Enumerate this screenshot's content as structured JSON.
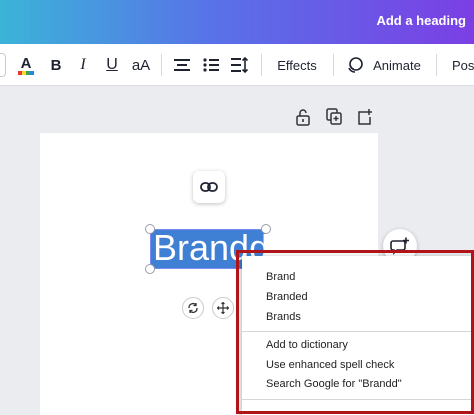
{
  "header": {
    "add_heading": "Add a heading"
  },
  "toolbar": {
    "text_color_icon": "text-color-icon",
    "bold_label": "B",
    "italic_label": "I",
    "underline_label": "U",
    "case_label": "aA",
    "effects_label": "Effects",
    "animate_label": "Animate",
    "position_label": "Pos"
  },
  "colors": {
    "accent_gradient_start": "#3bb4d8",
    "accent_gradient_end": "#7b3fe4",
    "selection": "#3f7fd4",
    "highlight_outline": "#b01418"
  },
  "canvas": {
    "text_value": "Brandd"
  },
  "context_menu": {
    "suggestions": [
      "Brand",
      "Branded",
      "Brands"
    ],
    "add_to_dictionary": "Add to dictionary",
    "enhanced_spell_check": "Use enhanced spell check",
    "search_google": "Search Google for \"Brandd\""
  }
}
